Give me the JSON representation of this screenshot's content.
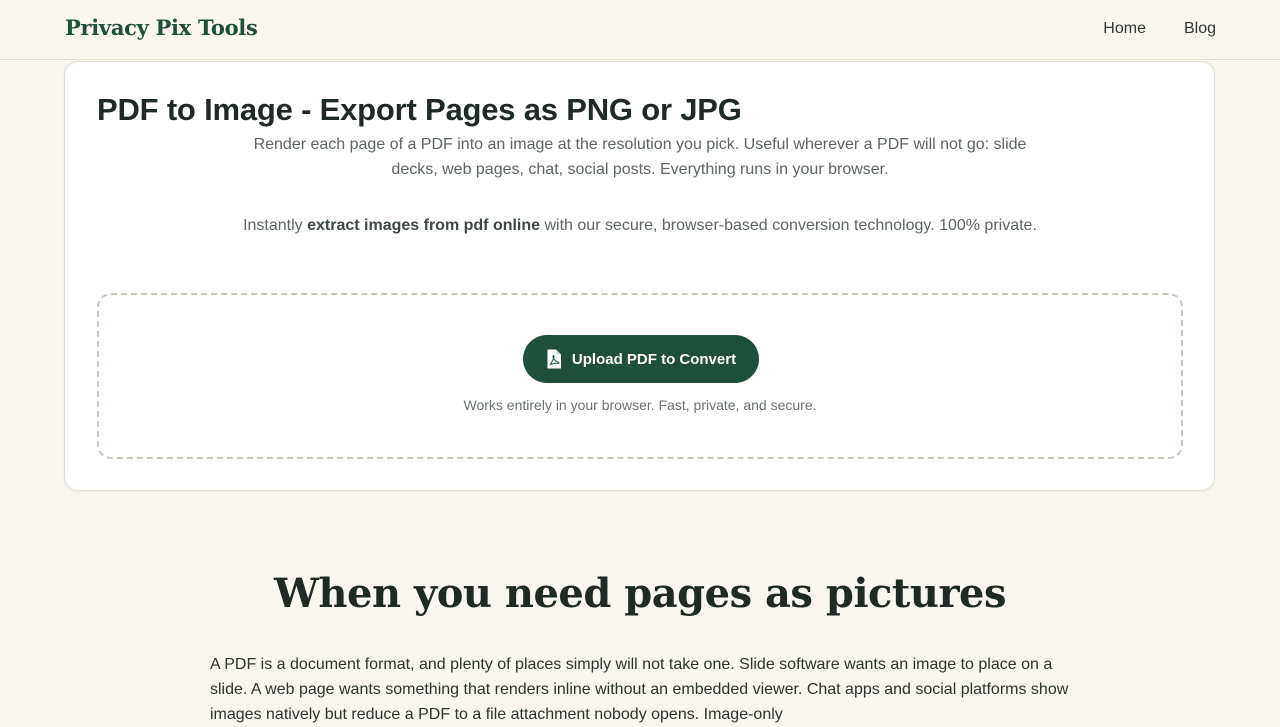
{
  "header": {
    "logo": "Privacy Pix Tools",
    "nav": [
      "Home",
      "Blog"
    ]
  },
  "tool": {
    "title": "PDF to Image - Export Pages as PNG or JPG",
    "description": "Render each page of a PDF into an image at the resolution you pick. Useful wherever a PDF will not go: slide decks, web pages, chat, social posts. Everything runs in your browser.",
    "subtitle_prefix": "Instantly ",
    "subtitle_bold": "extract images from pdf online",
    "subtitle_suffix": " with our secure, browser-based conversion technology. 100% private.",
    "upload_button": "Upload PDF to Convert",
    "upload_icon": "file-pdf-icon",
    "dropzone_note": "Works entirely in your browser. Fast, private, and secure."
  },
  "section": {
    "title": "When you need pages as pictures",
    "body": "A PDF is a document format, and plenty of places simply will not take one. Slide software wants an image to place on a slide. A web page wants something that renders inline without an embedded viewer. Chat apps and social platforms show images natively but reduce a PDF to a file attachment nobody opens. Image-only"
  },
  "colors": {
    "brand": "#1d4f3a",
    "background": "#f9f6f0",
    "card": "#ffffff"
  }
}
